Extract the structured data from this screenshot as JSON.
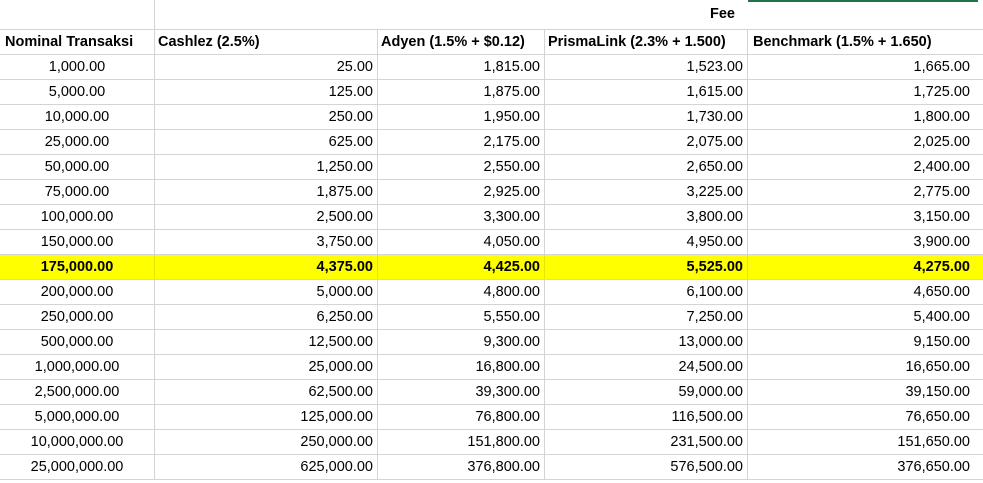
{
  "sheet": {
    "fee_header": "Fee",
    "columns": [
      "Nominal Transaksi",
      "Cashlez (2.5%)",
      "Adyen (1.5% + $0.12)",
      "PrismaLink (2.3% + 1.500)",
      "Benchmark (1.5% + 1.650)"
    ],
    "highlight_color": "#ffff00",
    "selection_color": "#217346",
    "rows": [
      [
        "1,000.00",
        "25.00",
        "1,815.00",
        "1,523.00",
        "1,665.00"
      ],
      [
        "5,000.00",
        "125.00",
        "1,875.00",
        "1,615.00",
        "1,725.00"
      ],
      [
        "10,000.00",
        "250.00",
        "1,950.00",
        "1,730.00",
        "1,800.00"
      ],
      [
        "25,000.00",
        "625.00",
        "2,175.00",
        "2,075.00",
        "2,025.00"
      ],
      [
        "50,000.00",
        "1,250.00",
        "2,550.00",
        "2,650.00",
        "2,400.00"
      ],
      [
        "75,000.00",
        "1,875.00",
        "2,925.00",
        "3,225.00",
        "2,775.00"
      ],
      [
        "100,000.00",
        "2,500.00",
        "3,300.00",
        "3,800.00",
        "3,150.00"
      ],
      [
        "150,000.00",
        "3,750.00",
        "4,050.00",
        "4,950.00",
        "3,900.00"
      ],
      [
        "175,000.00",
        "4,375.00",
        "4,425.00",
        "5,525.00",
        "4,275.00"
      ],
      [
        "200,000.00",
        "5,000.00",
        "4,800.00",
        "6,100.00",
        "4,650.00"
      ],
      [
        "250,000.00",
        "6,250.00",
        "5,550.00",
        "7,250.00",
        "5,400.00"
      ],
      [
        "500,000.00",
        "12,500.00",
        "9,300.00",
        "13,000.00",
        "9,150.00"
      ],
      [
        "1,000,000.00",
        "25,000.00",
        "16,800.00",
        "24,500.00",
        "16,650.00"
      ],
      [
        "2,500,000.00",
        "62,500.00",
        "39,300.00",
        "59,000.00",
        "39,150.00"
      ],
      [
        "5,000,000.00",
        "125,000.00",
        "76,800.00",
        "116,500.00",
        "76,650.00"
      ],
      [
        "10,000,000.00",
        "250,000.00",
        "151,800.00",
        "231,500.00",
        "151,650.00"
      ],
      [
        "25,000,000.00",
        "625,000.00",
        "376,800.00",
        "576,500.00",
        "376,650.00"
      ]
    ],
    "highlighted_row_index": 8
  }
}
